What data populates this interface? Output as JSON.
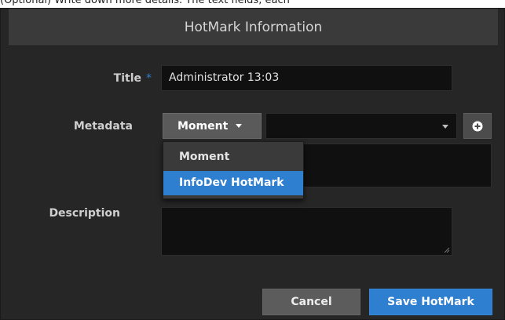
{
  "top_strip": {
    "text": "(Optional) Write down more details. The text fields, each"
  },
  "dialog": {
    "title": "HotMark Information",
    "title_label": "Title",
    "required_marker": "*",
    "title_value": "Administrator 13:03",
    "metadata_label": "Metadata",
    "metadata_button": "Moment",
    "metadata_select_value": "",
    "description_label": "Description",
    "description_value": "",
    "dropdown": {
      "options": [
        "Moment",
        "InfoDev HotMark"
      ],
      "highlighted": "InfoDev HotMark"
    },
    "cancel_label": "Cancel",
    "save_label": "Save HotMark"
  },
  "colors": {
    "accent": "#2f7fd0",
    "dialog_bg": "#262626",
    "header_bg": "#3a3a3a",
    "field_bg": "#101010"
  },
  "icons": [
    "chevron-down-icon",
    "plus-circle-icon",
    "resize-grip-icon"
  ]
}
